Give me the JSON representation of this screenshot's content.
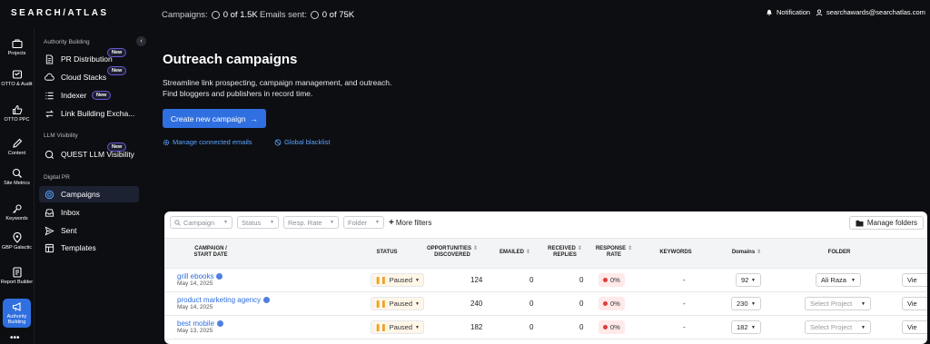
{
  "topbar": {
    "logo": "SEARCH/ATLAS",
    "campaigns_label": "Campaigns:",
    "campaigns_value": "0 of 1.5K",
    "emails_label": "Emails sent:",
    "emails_value": "0 of 75K",
    "notification": "Notification",
    "user_email": "searchawards@searchatlas.com"
  },
  "rail": {
    "items": [
      {
        "label": "Projects",
        "icon": "briefcase-icon"
      },
      {
        "label": "OTTO & Audit",
        "icon": "otto-icon"
      },
      {
        "label": "OTTO PPC",
        "icon": "thumb-icon"
      },
      {
        "label": "Content",
        "icon": "pen-icon"
      },
      {
        "label": "Site Metrics",
        "icon": "magnify-icon"
      },
      {
        "label": "Keywords",
        "icon": "key-icon"
      },
      {
        "label": "GBP Galactic",
        "icon": "pin-icon"
      },
      {
        "label": "Report Builder",
        "icon": "report-icon"
      },
      {
        "label": "Authority Building",
        "icon": "megaphone-icon"
      }
    ],
    "more": "•••"
  },
  "sidebar": {
    "section1": "Authority Building",
    "section2": "LLM Visibility",
    "section3": "Digital PR",
    "items": [
      {
        "label": "PR Distribution",
        "badge": "New"
      },
      {
        "label": "Cloud Stacks",
        "badge": "New"
      },
      {
        "label": "Indexer",
        "badge": "New"
      },
      {
        "label": "Link Building Excha..."
      },
      {
        "label": "QUEST LLM Visibility",
        "badge": "New"
      },
      {
        "label": "Campaigns"
      },
      {
        "label": "Inbox"
      },
      {
        "label": "Sent"
      },
      {
        "label": "Templates"
      }
    ]
  },
  "main": {
    "title": "Outreach campaigns",
    "desc_line1": "Streamline link prospecting, campaign management, and outreach.",
    "desc_line2": "Find bloggers and publishers in record time.",
    "cta": "Create new campaign",
    "cta_arrow": "→",
    "manage_emails": "Manage connected emails",
    "global_blacklist": "Global blacklist"
  },
  "filters": {
    "campaign_placeholder": "Campaign",
    "status": "Status",
    "resp_rate": "Resp. Rate",
    "folder": "Folder",
    "more": "More filters",
    "manage_folders": "Manage folders"
  },
  "table": {
    "headers": {
      "campaign_l1": "CAMPAIGN /",
      "campaign_l2": "START DATE",
      "status": "STATUS",
      "opp_l1": "OPPORTUNITIES",
      "opp_l2": "DISCOVERED",
      "emailed": "EMAILED",
      "rec_l1": "RECEIVED",
      "rec_l2": "REPLIES",
      "resp_l1": "RESPONSE",
      "resp_l2": "RATE",
      "keywords": "KEYWORDS",
      "domains": "Domains",
      "folder": "FOLDER"
    },
    "rows": [
      {
        "name": "grill ebooks",
        "date": "May 14, 2025",
        "status": "Paused",
        "opportunities": "124",
        "emailed": "0",
        "replies": "0",
        "rate": "0%",
        "keywords": "-",
        "domains": "92",
        "folder": "Ali Raza",
        "action": "Vie"
      },
      {
        "name": "product marketing agency",
        "date": "May 14, 2025",
        "status": "Paused",
        "opportunities": "240",
        "emailed": "0",
        "replies": "0",
        "rate": "0%",
        "keywords": "-",
        "domains": "230",
        "folder": "Select Project",
        "action": "Vie"
      },
      {
        "name": "best mobile",
        "date": "May 13, 2025",
        "status": "Paused",
        "opportunities": "182",
        "emailed": "0",
        "replies": "0",
        "rate": "0%",
        "keywords": "-",
        "domains": "182",
        "folder": "Select Project",
        "action": "Vie"
      }
    ]
  }
}
